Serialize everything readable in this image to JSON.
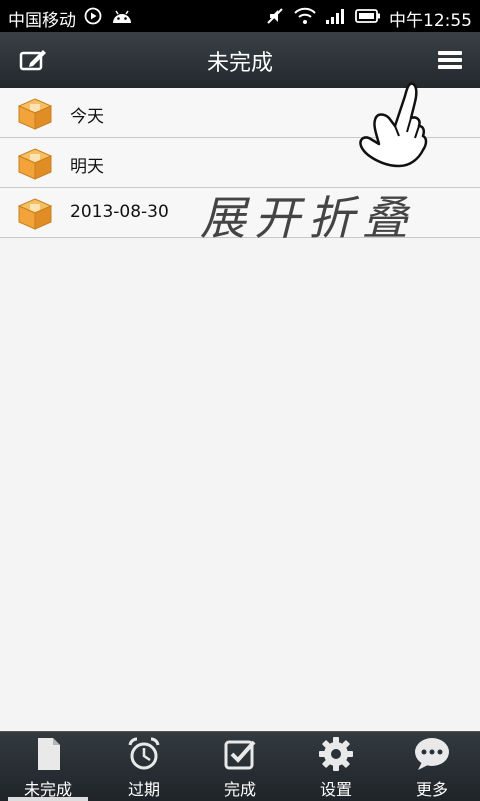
{
  "status": {
    "carrier": "中国移动",
    "time": "中午12:55",
    "icons": [
      "play-icon",
      "android-icon",
      "mute-icon",
      "wifi-icon",
      "signal-icon",
      "battery-icon"
    ]
  },
  "header": {
    "title": "未完成",
    "left_icon": "edit-icon",
    "right_icon": "menu-icon"
  },
  "list": {
    "items": [
      {
        "label": "今天",
        "icon": "box-icon"
      },
      {
        "label": "明天",
        "icon": "box-icon"
      },
      {
        "label": "2013-08-30",
        "icon": "box-icon"
      }
    ]
  },
  "overlay": {
    "handwriting": "展开折叠"
  },
  "tabs": [
    {
      "label": "未完成",
      "icon": "document-icon",
      "active": true
    },
    {
      "label": "过期",
      "icon": "alarm-clock-icon",
      "active": false
    },
    {
      "label": "完成",
      "icon": "checkbox-icon",
      "active": false
    },
    {
      "label": "设置",
      "icon": "gear-icon",
      "active": false
    },
    {
      "label": "更多",
      "icon": "chat-bubble-icon",
      "active": false
    }
  ],
  "colors": {
    "header_bg": "#2b3237",
    "tabbar_bg": "#262c31",
    "list_bg": "#f4f4f4",
    "box_orange": "#f2a33a"
  }
}
